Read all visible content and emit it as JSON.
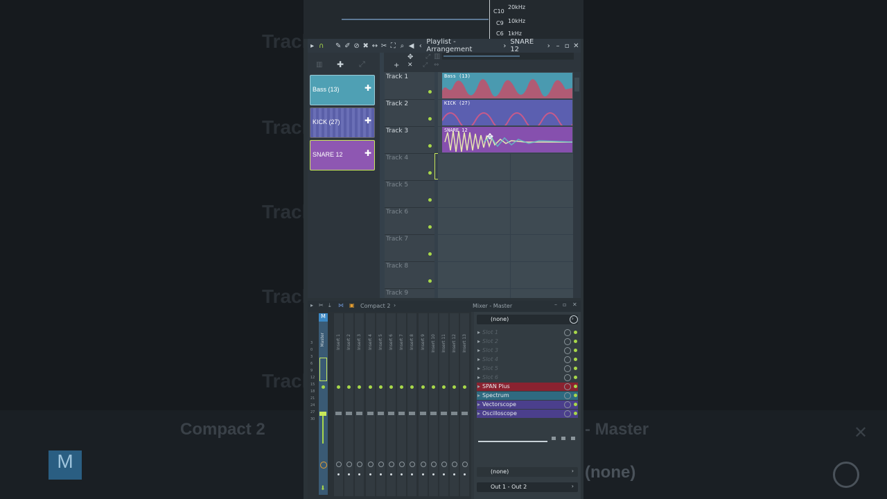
{
  "spectrum": {
    "freqs": [
      "20kHz",
      "10kHz",
      "1kHz"
    ],
    "notes": [
      "C10",
      "C9",
      "C6"
    ]
  },
  "playlist": {
    "title": "Playlist - Arrangement",
    "arrow": "›",
    "current": "SNARE 12",
    "patterns": [
      {
        "label": "Bass (13)",
        "color": "#4fa0b4"
      },
      {
        "label": "KICK (27)",
        "color": "#6a6fb6"
      },
      {
        "label": "SNARE 12",
        "color": "#8e57b2"
      }
    ],
    "tracks": [
      "Track 1",
      "Track 2",
      "Track 3",
      "Track 4",
      "Track 5",
      "Track 6",
      "Track 7",
      "Track 8",
      "Track 9"
    ],
    "clips": [
      {
        "label": "Bass (13)",
        "color": "#4a9ab0"
      },
      {
        "label": "KICK (27)",
        "color": "#5b5fb0"
      },
      {
        "label": "SNARE 12",
        "color": "#8650ae"
      }
    ]
  },
  "mixer": {
    "preset": "Compact 2",
    "title": "Mixer - Master",
    "master": "Master",
    "inserts": [
      "Insert 1",
      "Insert 2",
      "Insert 3",
      "Insert 4",
      "Insert 5",
      "Insert 6",
      "Insert 7",
      "Insert 8",
      "Insert 9",
      "Insert 10",
      "Insert 11",
      "Insert 12",
      "Insert 13"
    ],
    "top_select": "(none)",
    "slots": [
      {
        "name": "Slot 1",
        "active": false
      },
      {
        "name": "Slot 2",
        "active": false
      },
      {
        "name": "Slot 3",
        "active": false
      },
      {
        "name": "Slot 4",
        "active": false
      },
      {
        "name": "Slot 5",
        "active": false
      },
      {
        "name": "Slot 6",
        "active": false
      },
      {
        "name": "SPAN Plus",
        "active": true,
        "color": "#8a2230"
      },
      {
        "name": "Spectrum",
        "active": true,
        "color": "#2f6a80"
      },
      {
        "name": "Vectorscope",
        "active": true,
        "color": "#4b3f8c"
      },
      {
        "name": "Oscilloscope",
        "active": true,
        "color": "#4b3f8c"
      }
    ],
    "bottom_select": "(none)",
    "output": "Out 1 - Out 2"
  },
  "background": {
    "words": [
      "Track",
      "Track",
      "Track",
      "Track",
      "Track",
      "Compact 2",
      "- Master",
      "(none)"
    ],
    "mixer_m": "M"
  }
}
